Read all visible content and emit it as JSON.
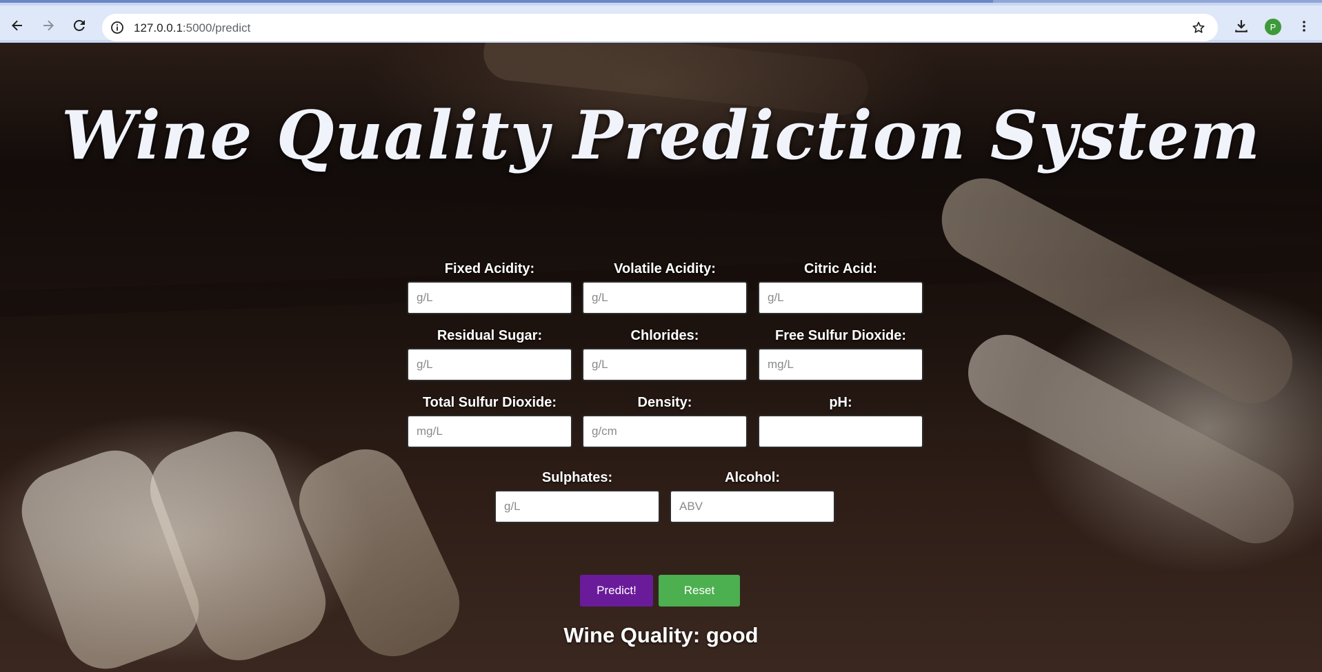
{
  "browser": {
    "url_host": "127.0.0.1",
    "url_path": ":5000/predict",
    "profile_initial": "P"
  },
  "page": {
    "title": "Wine Quality Prediction System",
    "fields": [
      {
        "label": "Fixed Acidity:",
        "placeholder": "g/L",
        "value": ""
      },
      {
        "label": "Volatile Acidity:",
        "placeholder": "g/L",
        "value": ""
      },
      {
        "label": "Citric Acid:",
        "placeholder": "g/L",
        "value": ""
      },
      {
        "label": "Residual Sugar:",
        "placeholder": "g/L",
        "value": ""
      },
      {
        "label": "Chlorides:",
        "placeholder": "g/L",
        "value": ""
      },
      {
        "label": "Free Sulfur Dioxide:",
        "placeholder": "mg/L",
        "value": ""
      },
      {
        "label": "Total Sulfur Dioxide:",
        "placeholder": "mg/L",
        "value": ""
      },
      {
        "label": "Density:",
        "placeholder": "g/cm",
        "value": ""
      },
      {
        "label": "pH:",
        "placeholder": "",
        "value": ""
      },
      {
        "label": "Sulphates:",
        "placeholder": "g/L",
        "value": ""
      },
      {
        "label": "Alcohol:",
        "placeholder": "ABV",
        "value": ""
      }
    ],
    "predict_label": "Predict!",
    "reset_label": "Reset",
    "result": "Wine Quality: good"
  },
  "icons": {
    "back": "arrow-left-icon",
    "forward": "arrow-right-icon",
    "reload": "reload-icon",
    "site_info": "info-icon",
    "bookmark": "star-icon",
    "download": "download-icon",
    "menu": "kebab-menu-icon"
  },
  "colors": {
    "predict_button": "#6a1b9a",
    "reset_button": "#4caf50",
    "title_text": "#f1f3fb",
    "profile_avatar": "#3d9a3a"
  }
}
